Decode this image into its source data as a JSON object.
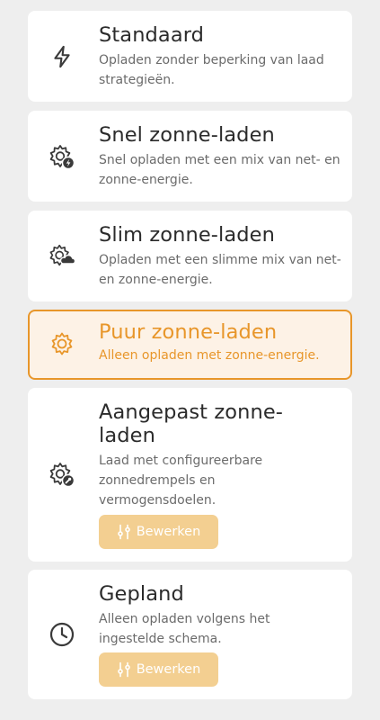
{
  "colors": {
    "accent": "#e8962a",
    "icon": "#3a3a3a",
    "button_bg": "#f3cf91"
  },
  "modes": [
    {
      "title": "Standaard",
      "description": "Opladen zonder beperking van laad strategieën.",
      "icon": "lightning-icon",
      "selected": false
    },
    {
      "title": "Snel zonne-laden",
      "description": "Snel opladen met een mix van net- en zonne-energie.",
      "icon": "sun-lightning-icon",
      "selected": false
    },
    {
      "title": "Slim zonne-laden",
      "description": "Opladen met een slimme mix van net- en zonne-energie.",
      "icon": "sun-cloud-icon",
      "selected": false
    },
    {
      "title": "Puur zonne-laden",
      "description": "Alleen opladen met zonne-energie.",
      "icon": "sun-icon",
      "selected": true
    },
    {
      "title": "Aangepast zonne-laden",
      "description": "Laad met configureerbare zonnedrempels en vermogensdoelen.",
      "icon": "sun-wrench-icon",
      "selected": false,
      "edit_label": "Bewerken",
      "edit_icon": "sliders-icon"
    },
    {
      "title": "Gepland",
      "description": "Alleen opladen volgens het ingestelde schema.",
      "icon": "clock-icon",
      "selected": false,
      "edit_label": "Bewerken",
      "edit_icon": "sliders-icon"
    }
  ]
}
